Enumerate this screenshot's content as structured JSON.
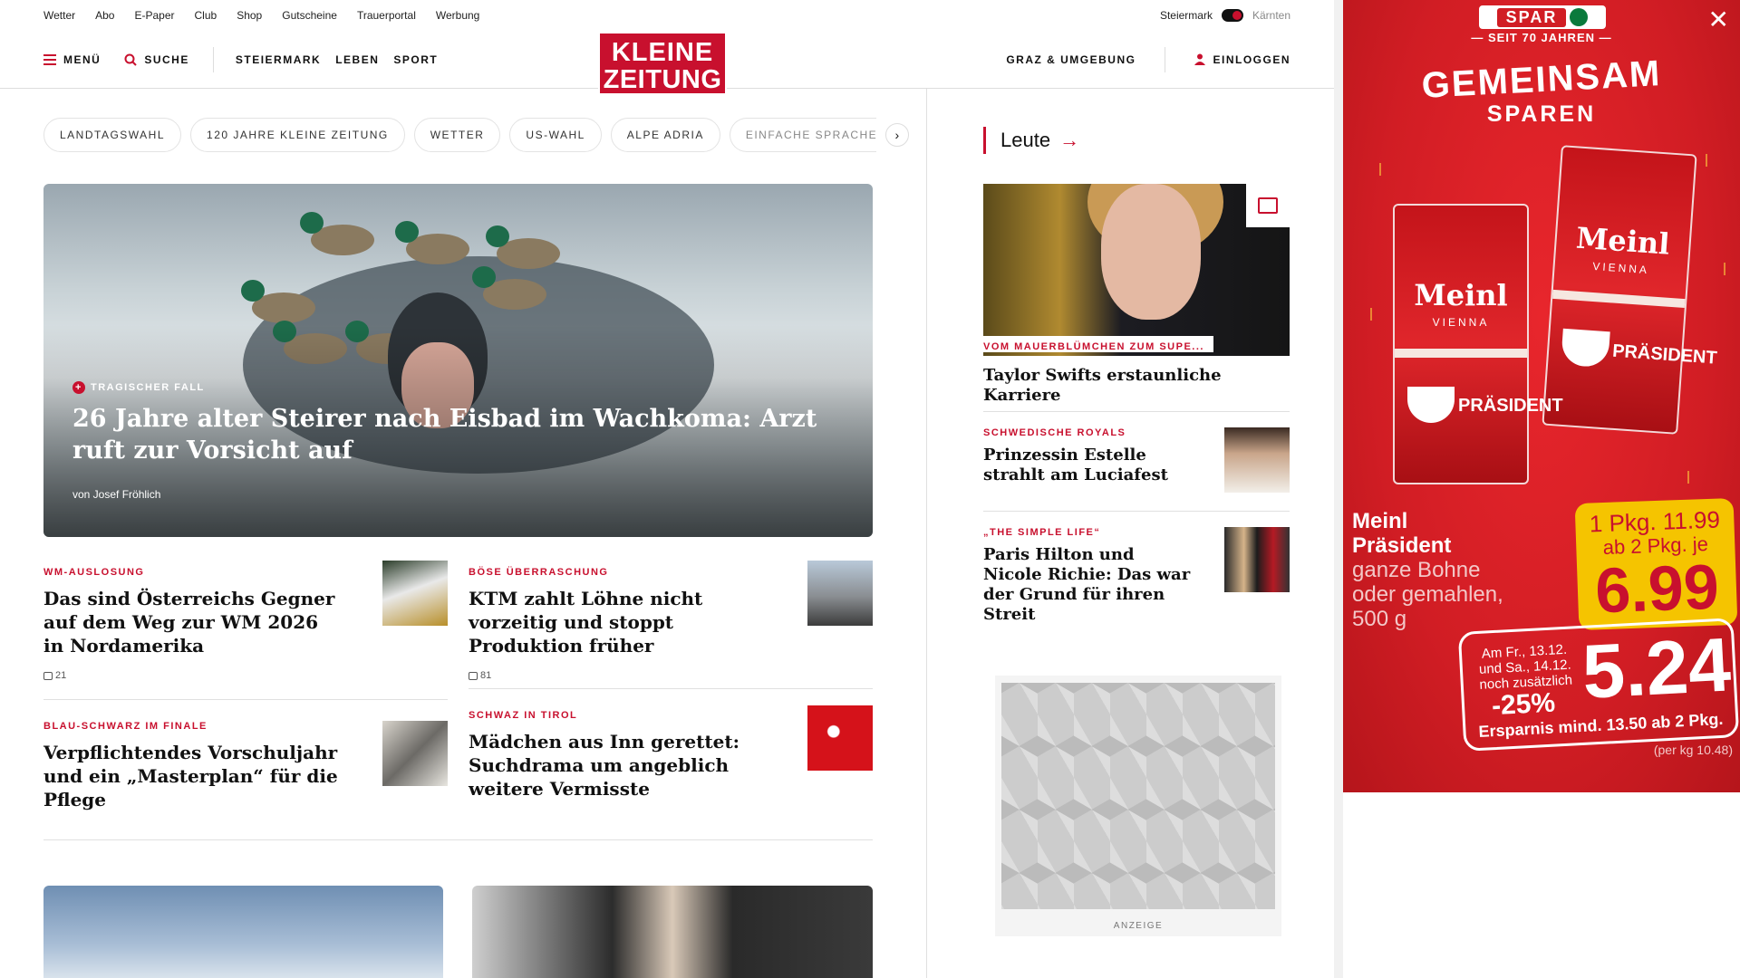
{
  "topbar": {
    "links": [
      "Wetter",
      "Abo",
      "E-Paper",
      "Club",
      "Shop",
      "Gutscheine",
      "Trauerportal",
      "Werbung"
    ],
    "region_active": "Steiermark",
    "region_inactive": "Kärnten"
  },
  "nav": {
    "menu": "MENÜ",
    "search": "SUCHE",
    "sections": [
      "STEIERMARK",
      "LEBEN",
      "SPORT"
    ],
    "local": "GRAZ & UMGEBUNG",
    "login": "EINLOGGEN",
    "logo_line1": "KLEINE",
    "logo_line2": "ZEITUNG"
  },
  "chips": [
    "LANDTAGSWAHL",
    "120 JAHRE KLEINE ZEITUNG",
    "WETTER",
    "US-WAHL",
    "ALPE ADRIA",
    "EINFACHE SPRACHE"
  ],
  "hero": {
    "kicker": "TRAGISCHER FALL",
    "title": "26 Jahre alter Steirer nach Eisbad im Wachkoma: Arzt ruft zur Vorsicht auf",
    "author": "von Josef Fröhlich"
  },
  "articles": [
    {
      "kicker": "WM-AUSLOSUNG",
      "title": "Das sind Österreichs Gegner auf dem Weg zur WM 2026 in Nordamerika",
      "comments": "21"
    },
    {
      "kicker": "BÖSE ÜBERRASCHUNG",
      "title": "KTM zahlt Löhne nicht vorzeitig und stoppt Produktion früher",
      "comments": "81"
    },
    {
      "kicker": "BLAU-SCHWARZ IM FINALE",
      "title": "Verpflichtendes Vorschuljahr und ein „Masterplan“ für die Pflege"
    },
    {
      "kicker": "SCHWAZ IN TIROL",
      "title": "Mädchen aus Inn gerettet: Suchdrama um angeblich weitere Vermisste"
    }
  ],
  "sidebar": {
    "section": "Leute",
    "hero_kicker": "VOM MAUERBLÜMCHEN ZUM SUPE...",
    "hero_title": "Taylor Swifts erstaunliche Karriere",
    "items": [
      {
        "kicker": "SCHWEDISCHE ROYALS",
        "title": "Prinzessin Estelle strahlt am Luciafest"
      },
      {
        "kicker": "„THE SIMPLE LIFE“",
        "title": "Paris Hilton und Nicole Richie: Das war der Grund für ihren Streit"
      }
    ],
    "ad_label": "ANZEIGE"
  },
  "ad": {
    "brand": "SPAR",
    "since": "— SEIT 70 JAHREN —",
    "headline1": "GEMEINSAM",
    "headline2": "SPAREN",
    "pack_brand": "Meinl",
    "pack_sub": "VIENNA",
    "pack_name": "PRÄSIDENT",
    "product_name": "Meinl",
    "product_name2": "Präsident",
    "product_desc1": "ganze Bohne",
    "product_desc2": "oder gemahlen,",
    "product_desc3": "500 g",
    "price_single": "1 Pkg. 11.99",
    "price_multi_label": "ab 2 Pkg. je",
    "price_multi": "6.99",
    "extra_date": "Am Fr., 13.12. und Sa., 14.12. noch zusätzlich",
    "extra_pct": "-25%",
    "extra_price": "5.24",
    "savings": "Ersparnis mind. 13.50 ab 2 Pkg.",
    "per_kg": "(per kg 10.48)"
  },
  "colors": {
    "accent": "#c8102e",
    "ad_red": "#d11d24",
    "ad_yellow": "#f5c400"
  }
}
